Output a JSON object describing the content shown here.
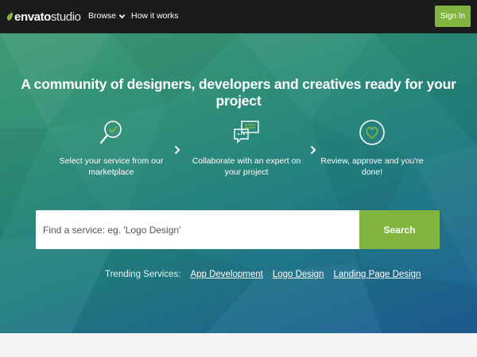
{
  "header": {
    "logo_bold": "envato",
    "logo_light": "studio",
    "nav_browse": "Browse",
    "nav_how": "How it works",
    "signin_label": "Sign In"
  },
  "hero": {
    "headline": "A community of designers, developers and creatives ready for your project",
    "steps": [
      {
        "icon": "magnifier-check-icon",
        "text": "Select your service from our marketplace"
      },
      {
        "icon": "chat-bubbles-icon",
        "text": "Collaborate with an expert on your project"
      },
      {
        "icon": "heart-circle-icon",
        "text": "Review, approve and you're done!"
      }
    ],
    "search": {
      "placeholder": "Find a service: eg. 'Logo Design'",
      "button_label": "Search"
    },
    "trending": {
      "label": "Trending Services:",
      "links": [
        "App Development",
        "Logo Design",
        "Landing Page Design"
      ]
    }
  },
  "colors": {
    "accent_green": "#82b540",
    "topbar": "#1b1b1b",
    "hero_start": "#3f9a73",
    "hero_end": "#1f5f96"
  }
}
